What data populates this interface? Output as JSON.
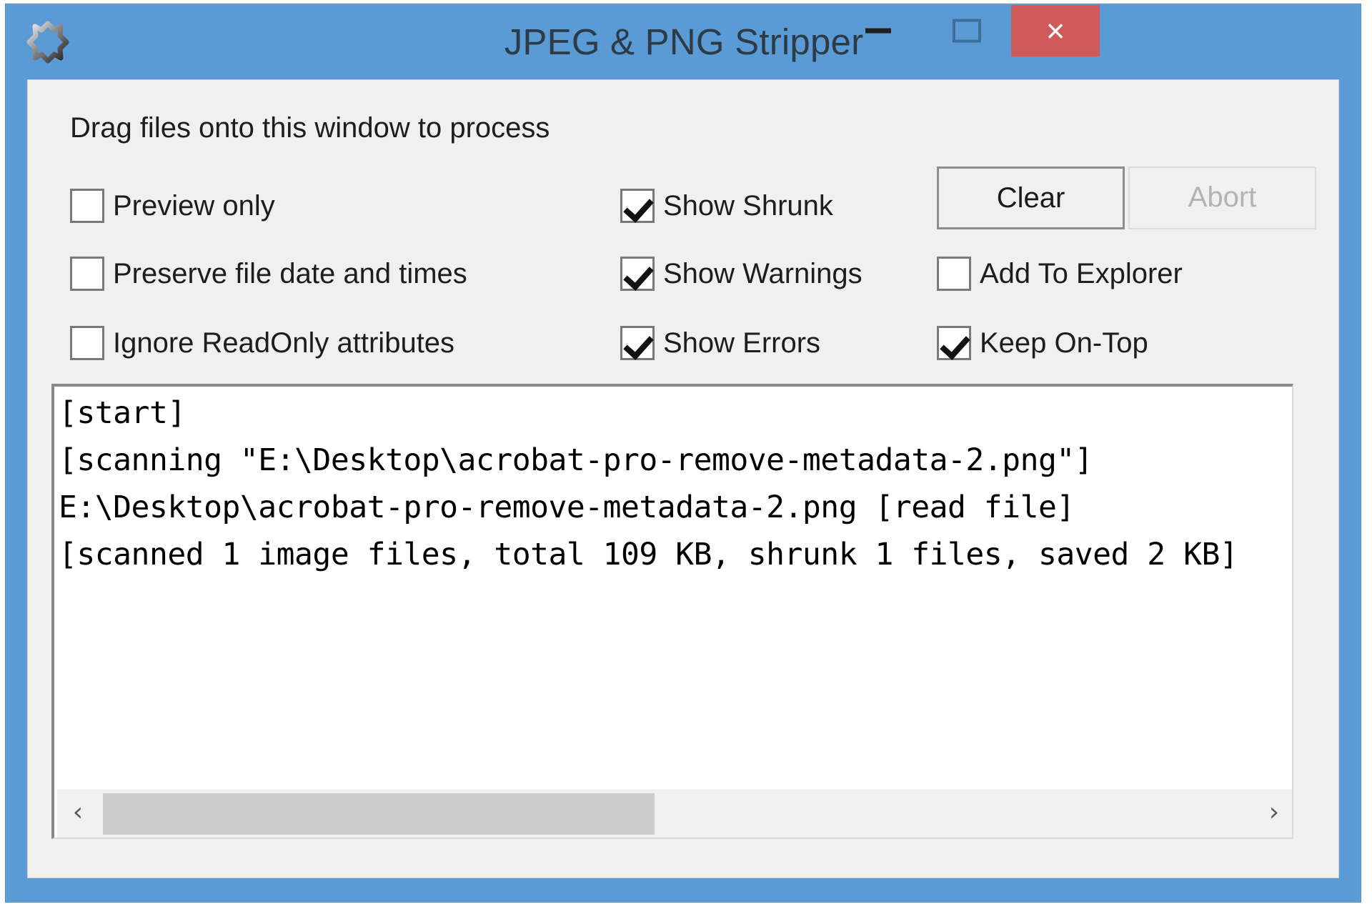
{
  "window": {
    "title": "JPEG & PNG Stripper",
    "app_icon": "chain-link-icon",
    "accent_titlebar_color": "#5b9bd5",
    "close_button_color": "#d05a5a",
    "controls": {
      "minimize_label": "",
      "maximize_label": "",
      "close_label": "×"
    }
  },
  "main": {
    "drag_hint": "Drag files onto this window to process",
    "checkboxes": [
      {
        "id": "preview-only",
        "label": "Preview only",
        "checked": false,
        "column": 1,
        "row": 1
      },
      {
        "id": "preserve-file-dates",
        "label": "Preserve file date and times",
        "checked": false,
        "column": 1,
        "row": 2
      },
      {
        "id": "ignore-readonly",
        "label": "Ignore ReadOnly attributes",
        "checked": false,
        "column": 1,
        "row": 3
      },
      {
        "id": "show-shrunk",
        "label": "Show Shrunk",
        "checked": true,
        "column": 2,
        "row": 1
      },
      {
        "id": "show-warnings",
        "label": "Show Warnings",
        "checked": true,
        "column": 2,
        "row": 2
      },
      {
        "id": "show-errors",
        "label": "Show Errors",
        "checked": true,
        "column": 2,
        "row": 3
      },
      {
        "id": "add-to-explorer",
        "label": "Add To Explorer",
        "checked": false,
        "column": 3,
        "row": 2
      },
      {
        "id": "keep-on-top",
        "label": "Keep On-Top",
        "checked": true,
        "column": 3,
        "row": 3
      }
    ],
    "buttons": {
      "clear_label": "Clear",
      "clear_enabled": true,
      "abort_label": "Abort",
      "abort_enabled": false
    },
    "log": {
      "lines": [
        "[start]",
        "[scanning \"E:\\Desktop\\acrobat-pro-remove-metadata-2.png\"]",
        "E:\\Desktop\\acrobat-pro-remove-metadata-2.png [read file]",
        "[scanned 1 image files, total 109 KB, shrunk 1 files, saved 2 KB]"
      ],
      "text": "[start]\n[scanning \"E:\\Desktop\\acrobat-pro-remove-metadata-2.png\"]\nE:\\Desktop\\acrobat-pro-remove-metadata-2.png [read file]\n[scanned 1 image files, total 109 KB, shrunk 1 files, saved 2 KB]",
      "scrollbar": {
        "left_arrow": "‹",
        "right_arrow": "›",
        "thumb_position_percent": 0,
        "thumb_width_percent": 46
      }
    }
  }
}
